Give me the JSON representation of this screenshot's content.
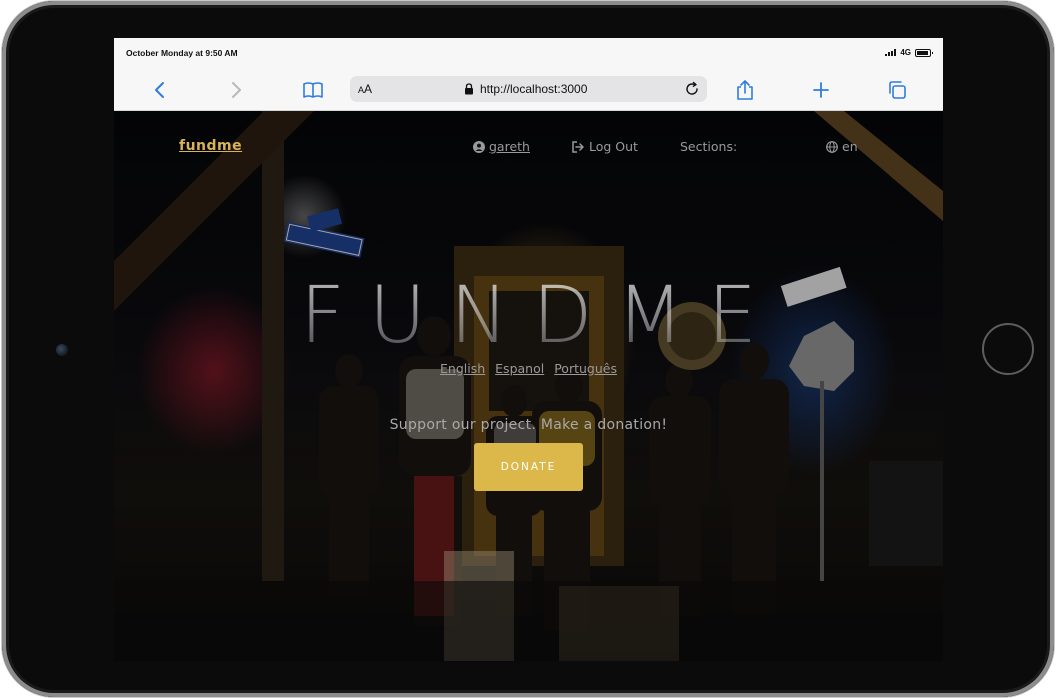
{
  "status_bar": {
    "time": "October Monday at 9:50 AM",
    "network": "4G"
  },
  "browser": {
    "reader_mode_label_small": "A",
    "reader_mode_label": "A",
    "url": "http://localhost:3000"
  },
  "nav": {
    "brand": "fundme",
    "user": "gareth",
    "logout": "Log Out",
    "sections": "Sections:",
    "language": "en"
  },
  "hero": {
    "title": "FUNDME",
    "languages": [
      "English",
      "Espanol",
      "Português"
    ],
    "tagline": "Support our project. Make a donation!",
    "donate_label": "DONATE"
  },
  "colors": {
    "accent": "#dcb84a",
    "brand_link": "#d9b25a",
    "browser_blue": "#2f7ce0"
  }
}
